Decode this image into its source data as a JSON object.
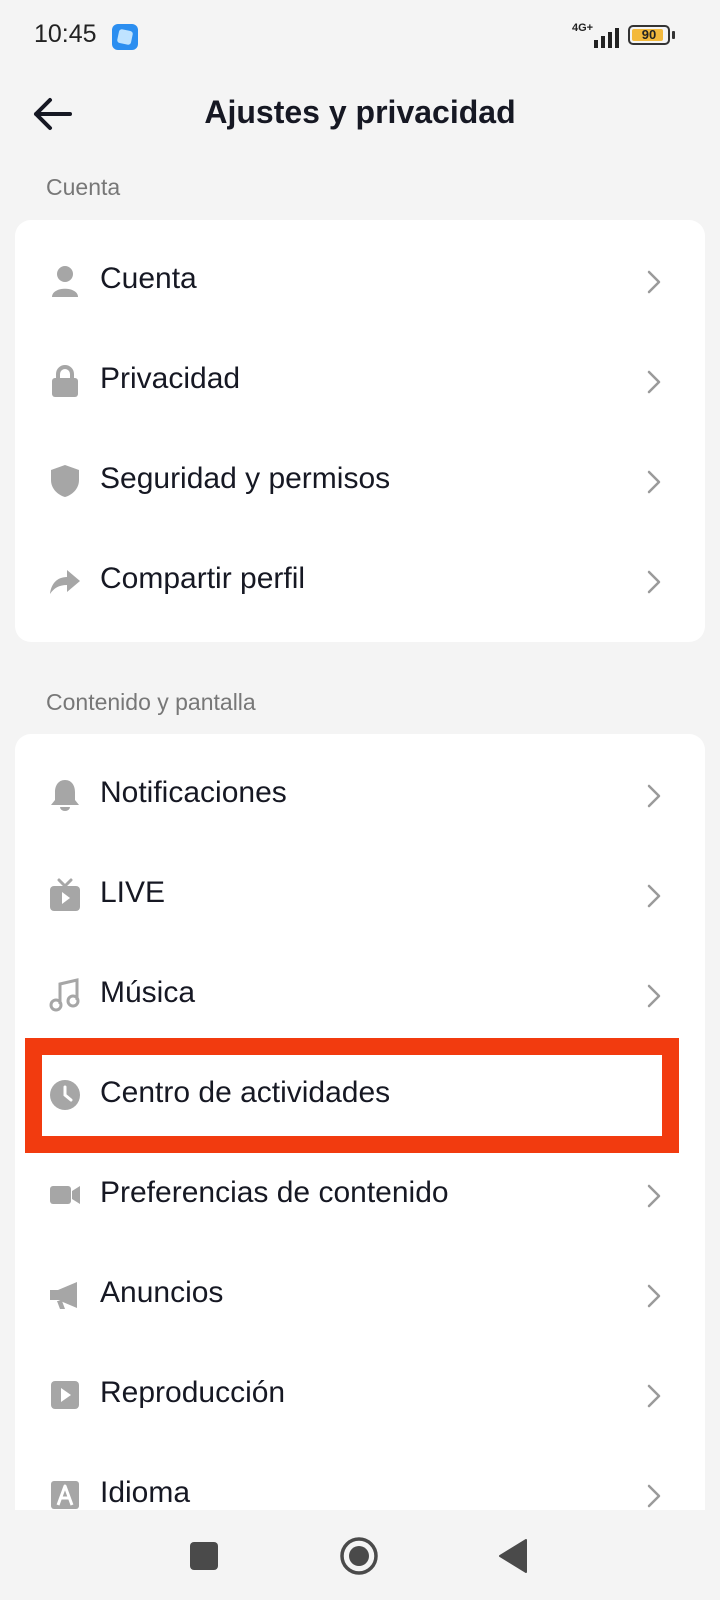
{
  "status_bar": {
    "time": "10:45",
    "network": "4G+",
    "battery": 90
  },
  "header": {
    "title": "Ajustes y privacidad"
  },
  "sections": [
    {
      "title": "Cuenta",
      "items": [
        {
          "label": "Cuenta",
          "icon": "person-icon"
        },
        {
          "label": "Privacidad",
          "icon": "lock-icon"
        },
        {
          "label": "Seguridad y permisos",
          "icon": "shield-icon"
        },
        {
          "label": "Compartir perfil",
          "icon": "share-icon"
        }
      ]
    },
    {
      "title": "Contenido y pantalla",
      "items": [
        {
          "label": "Notificaciones",
          "icon": "bell-icon"
        },
        {
          "label": "LIVE",
          "icon": "tv-icon"
        },
        {
          "label": "Música",
          "icon": "music-note-icon"
        },
        {
          "label": "Centro de actividades",
          "icon": "clock-icon"
        },
        {
          "label": "Preferencias de contenido",
          "icon": "video-camera-icon"
        },
        {
          "label": "Anuncios",
          "icon": "megaphone-icon"
        },
        {
          "label": "Reproducción",
          "icon": "play-icon"
        },
        {
          "label": "Idioma",
          "icon": "language-icon"
        }
      ]
    }
  ],
  "colors": {
    "highlight": "#f23b0f",
    "icon_gray": "#a6a6a6",
    "background": "#f4f4f4"
  }
}
